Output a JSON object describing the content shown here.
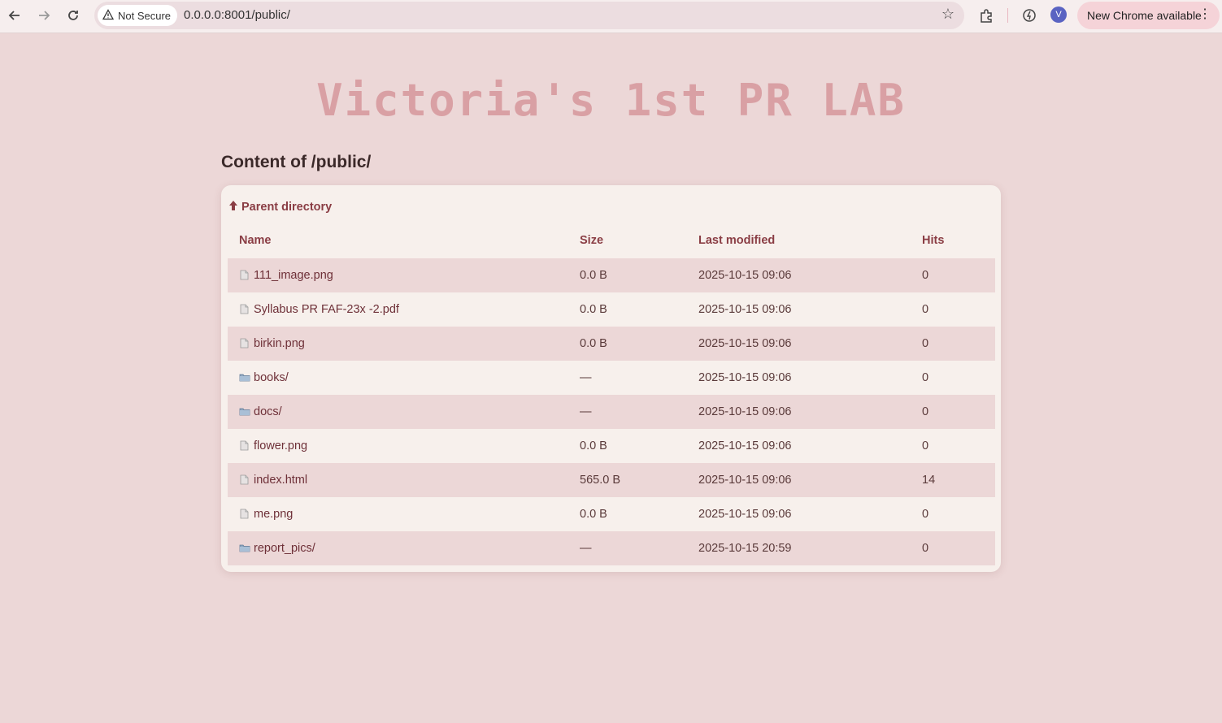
{
  "browser": {
    "security_label": "Not Secure",
    "url": "0.0.0.0:8001/public/",
    "update_label": "New Chrome available",
    "profile_initial": "V"
  },
  "page": {
    "site_title": "Victoria's 1st PR LAB",
    "heading": "Content of /public/",
    "parent_label": "Parent directory"
  },
  "table": {
    "headers": {
      "name": "Name",
      "size": "Size",
      "modified": "Last modified",
      "hits": "Hits"
    },
    "rows": [
      {
        "type": "file",
        "name": "111_image.png",
        "size": "0.0 B",
        "modified": "2025-10-15 09:06",
        "hits": "0"
      },
      {
        "type": "file",
        "name": "Syllabus PR FAF-23x -2.pdf",
        "size": "0.0 B",
        "modified": "2025-10-15 09:06",
        "hits": "0"
      },
      {
        "type": "file",
        "name": "birkin.png",
        "size": "0.0 B",
        "modified": "2025-10-15 09:06",
        "hits": "0"
      },
      {
        "type": "folder",
        "name": "books/",
        "size": "—",
        "modified": "2025-10-15 09:06",
        "hits": "0"
      },
      {
        "type": "folder",
        "name": "docs/",
        "size": "—",
        "modified": "2025-10-15 09:06",
        "hits": "0"
      },
      {
        "type": "file",
        "name": "flower.png",
        "size": "0.0 B",
        "modified": "2025-10-15 09:06",
        "hits": "0"
      },
      {
        "type": "file",
        "name": "index.html",
        "size": "565.0 B",
        "modified": "2025-10-15 09:06",
        "hits": "14"
      },
      {
        "type": "file",
        "name": "me.png",
        "size": "0.0 B",
        "modified": "2025-10-15 09:06",
        "hits": "0"
      },
      {
        "type": "folder",
        "name": "report_pics/",
        "size": "—",
        "modified": "2025-10-15 20:59",
        "hits": "0"
      }
    ]
  },
  "colors": {
    "page_bg": "#ecd7d7",
    "panel_bg": "#f7f0ec",
    "accent": "#8a3d44",
    "title": "#d9a0a4"
  }
}
